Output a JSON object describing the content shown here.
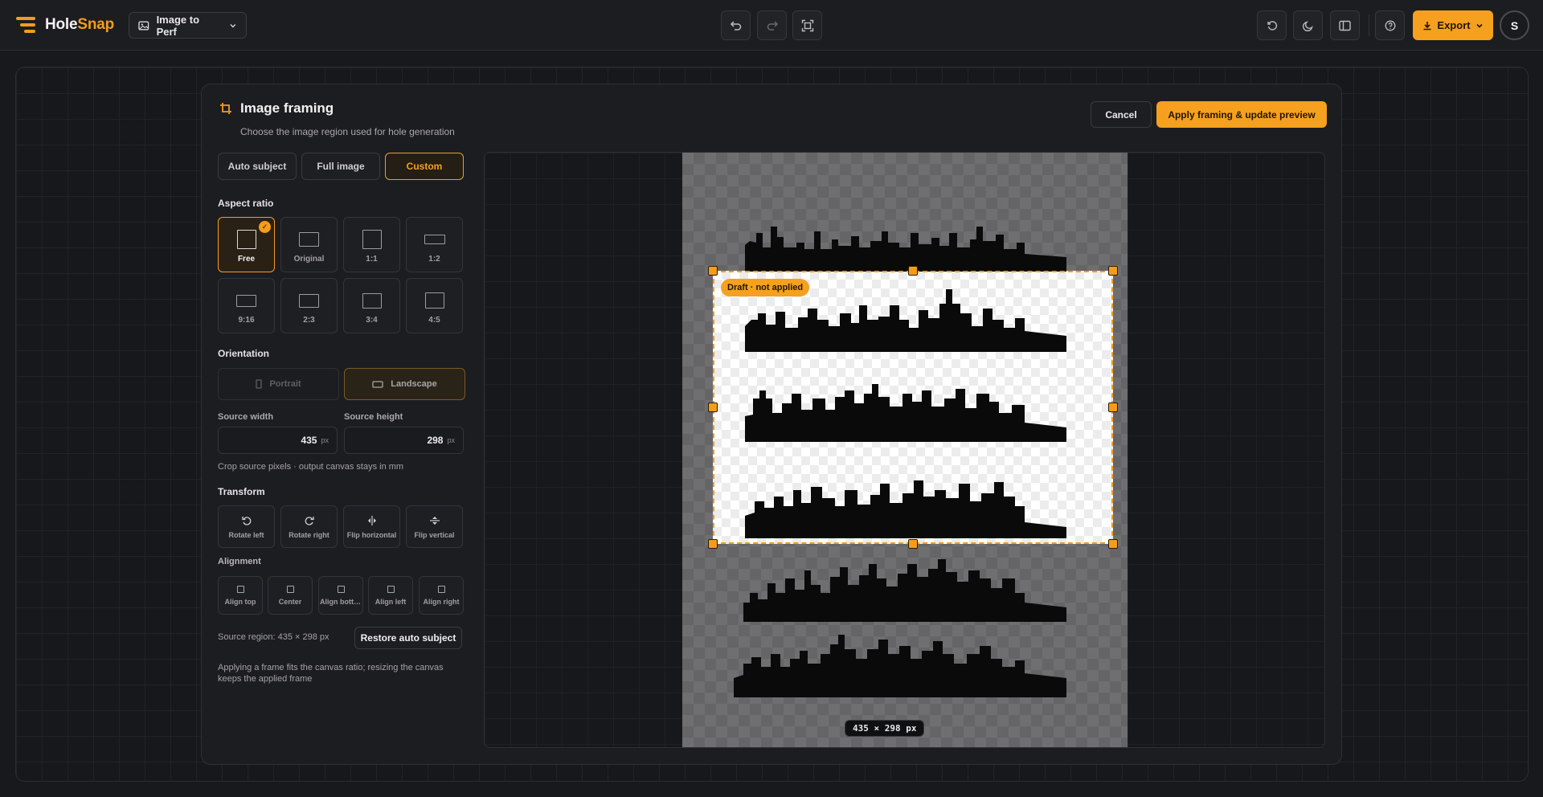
{
  "app": {
    "name_part1": "Hole",
    "name_part2": "Snap",
    "mode_label": "Image to Perf",
    "export_label": "Export",
    "avatar_initial": "S",
    "accent_color": "#f5a01f"
  },
  "modal": {
    "title": "Image framing",
    "subtitle": "Choose the image region used for hole generation",
    "cancel_label": "Cancel",
    "apply_label": "Apply framing & update preview"
  },
  "source_tabs": [
    "Auto subject",
    "Full image",
    "Custom"
  ],
  "source_tab_selected": "Custom",
  "aspect": {
    "label": "Aspect ratio",
    "selected": "Free",
    "options": [
      "Free",
      "Original",
      "1:1",
      "1:2",
      "9:16",
      "2:3",
      "3:4",
      "4:5"
    ]
  },
  "orientation": {
    "label": "Orientation",
    "portrait_label": "Portrait",
    "landscape_label": "Landscape",
    "selected": "Landscape"
  },
  "source": {
    "width_label": "Source width",
    "width_value": "435",
    "height_label": "Source height",
    "height_value": "298",
    "unit": "px",
    "hint": "Crop source pixels · output canvas stays in mm"
  },
  "transform": {
    "label": "Transform",
    "buttons": [
      "Rotate left",
      "Rotate right",
      "Flip horizontal",
      "Flip vertical"
    ]
  },
  "alignment": {
    "label": "Alignment",
    "buttons": [
      "Align top",
      "Center",
      "Align bottom",
      "Align left",
      "Align right"
    ]
  },
  "footer": {
    "region_text": "Source region: 435 × 298 px",
    "restore_label": "Restore auto subject",
    "note": "Applying a frame fits the canvas ratio; resizing the canvas keeps the applied frame"
  },
  "preview": {
    "draft_badge": "Draft · not applied",
    "size_badge": "435 × 298 px"
  }
}
